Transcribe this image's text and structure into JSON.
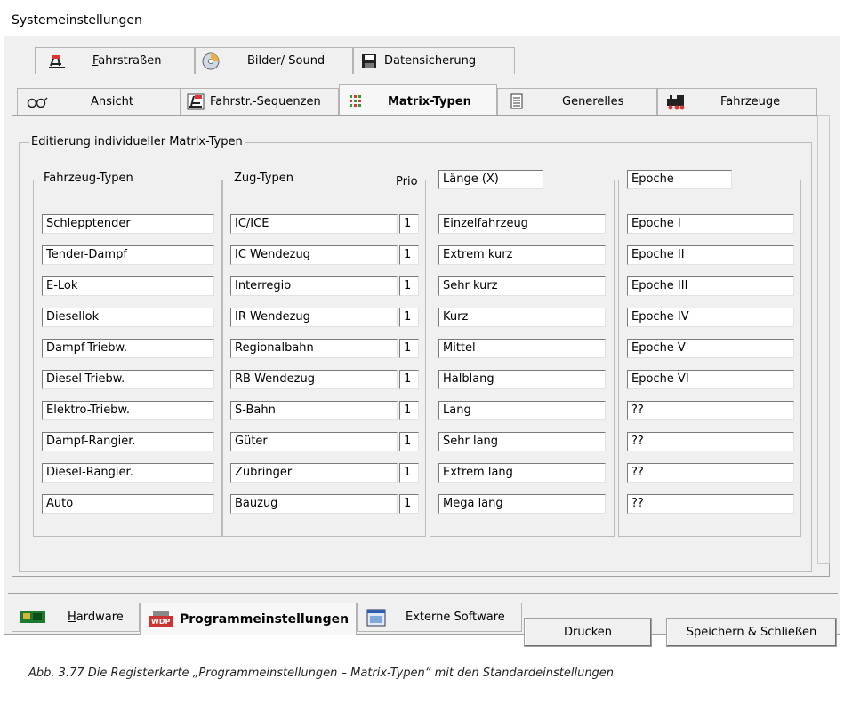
{
  "window": {
    "title": "Systemeinstellungen"
  },
  "tabs_row1": [
    {
      "label": "Fahrstraßen",
      "icon": "route-icon"
    },
    {
      "label": "Bilder/ Sound",
      "icon": "cd-icon"
    },
    {
      "label": "Datensicherung",
      "icon": "floppy-disk-icon"
    }
  ],
  "tabs_row2": [
    {
      "label": "Ansicht",
      "icon": "glasses-icon"
    },
    {
      "label": "Fahrstr.-Sequenzen",
      "icon": "sequence-icon"
    },
    {
      "label": "Matrix-Typen",
      "icon": "matrix-icon",
      "active": true
    },
    {
      "label": "Generelles",
      "icon": "document-icon"
    },
    {
      "label": "Fahrzeuge",
      "icon": "locomotive-icon"
    }
  ],
  "main_group": {
    "title": "Editierung individueller Matrix-Typen"
  },
  "vehicle_types": {
    "title": "Fahrzeug-Typen",
    "values": [
      "Schlepptender",
      "Tender-Dampf",
      "E-Lok",
      "Diesellok",
      "Dampf-Triebw.",
      "Diesel-Triebw.",
      "Elektro-Triebw.",
      "Dampf-Rangier.",
      "Diesel-Rangier.",
      "Auto"
    ]
  },
  "train_types": {
    "title": "Zug-Typen",
    "prio_label": "Prio",
    "values": [
      "IC/ICE",
      "IC Wendezug",
      "Interregio",
      "IR Wendezug",
      "Regionalbahn",
      "RB Wendezug",
      "S-Bahn",
      "Güter",
      "Zubringer",
      "Bauzug"
    ],
    "prios": [
      "1",
      "1",
      "1",
      "1",
      "1",
      "1",
      "1",
      "1",
      "1",
      "1"
    ]
  },
  "length_types": {
    "title": "Länge (X)",
    "values": [
      "Einzelfahrzeug",
      "Extrem kurz",
      "Sehr kurz",
      "Kurz",
      "Mittel",
      "Halblang",
      "Lang",
      "Sehr lang",
      "Extrem lang",
      "Mega lang"
    ]
  },
  "epoch_types": {
    "title": "Epoche",
    "values": [
      "Epoche I",
      "Epoche II",
      "Epoche III",
      "Epoche IV",
      "Epoche V",
      "Epoche VI",
      "??",
      "??",
      "??",
      "??"
    ]
  },
  "bottom_tabs": [
    {
      "label": "Hardware",
      "icon": "hardware-board-icon"
    },
    {
      "label": "Programmeinstellungen",
      "icon": "program-settings-icon",
      "active": true
    },
    {
      "label": "Externe Software",
      "icon": "external-software-icon"
    }
  ],
  "buttons": {
    "print": "Drucken",
    "save_close": "Speichern & Schließen"
  },
  "caption": "Abb. 3.77    Die Registerkarte „Programmeinstellungen – Matrix-Typen“ mit den Standardeinstellungen"
}
